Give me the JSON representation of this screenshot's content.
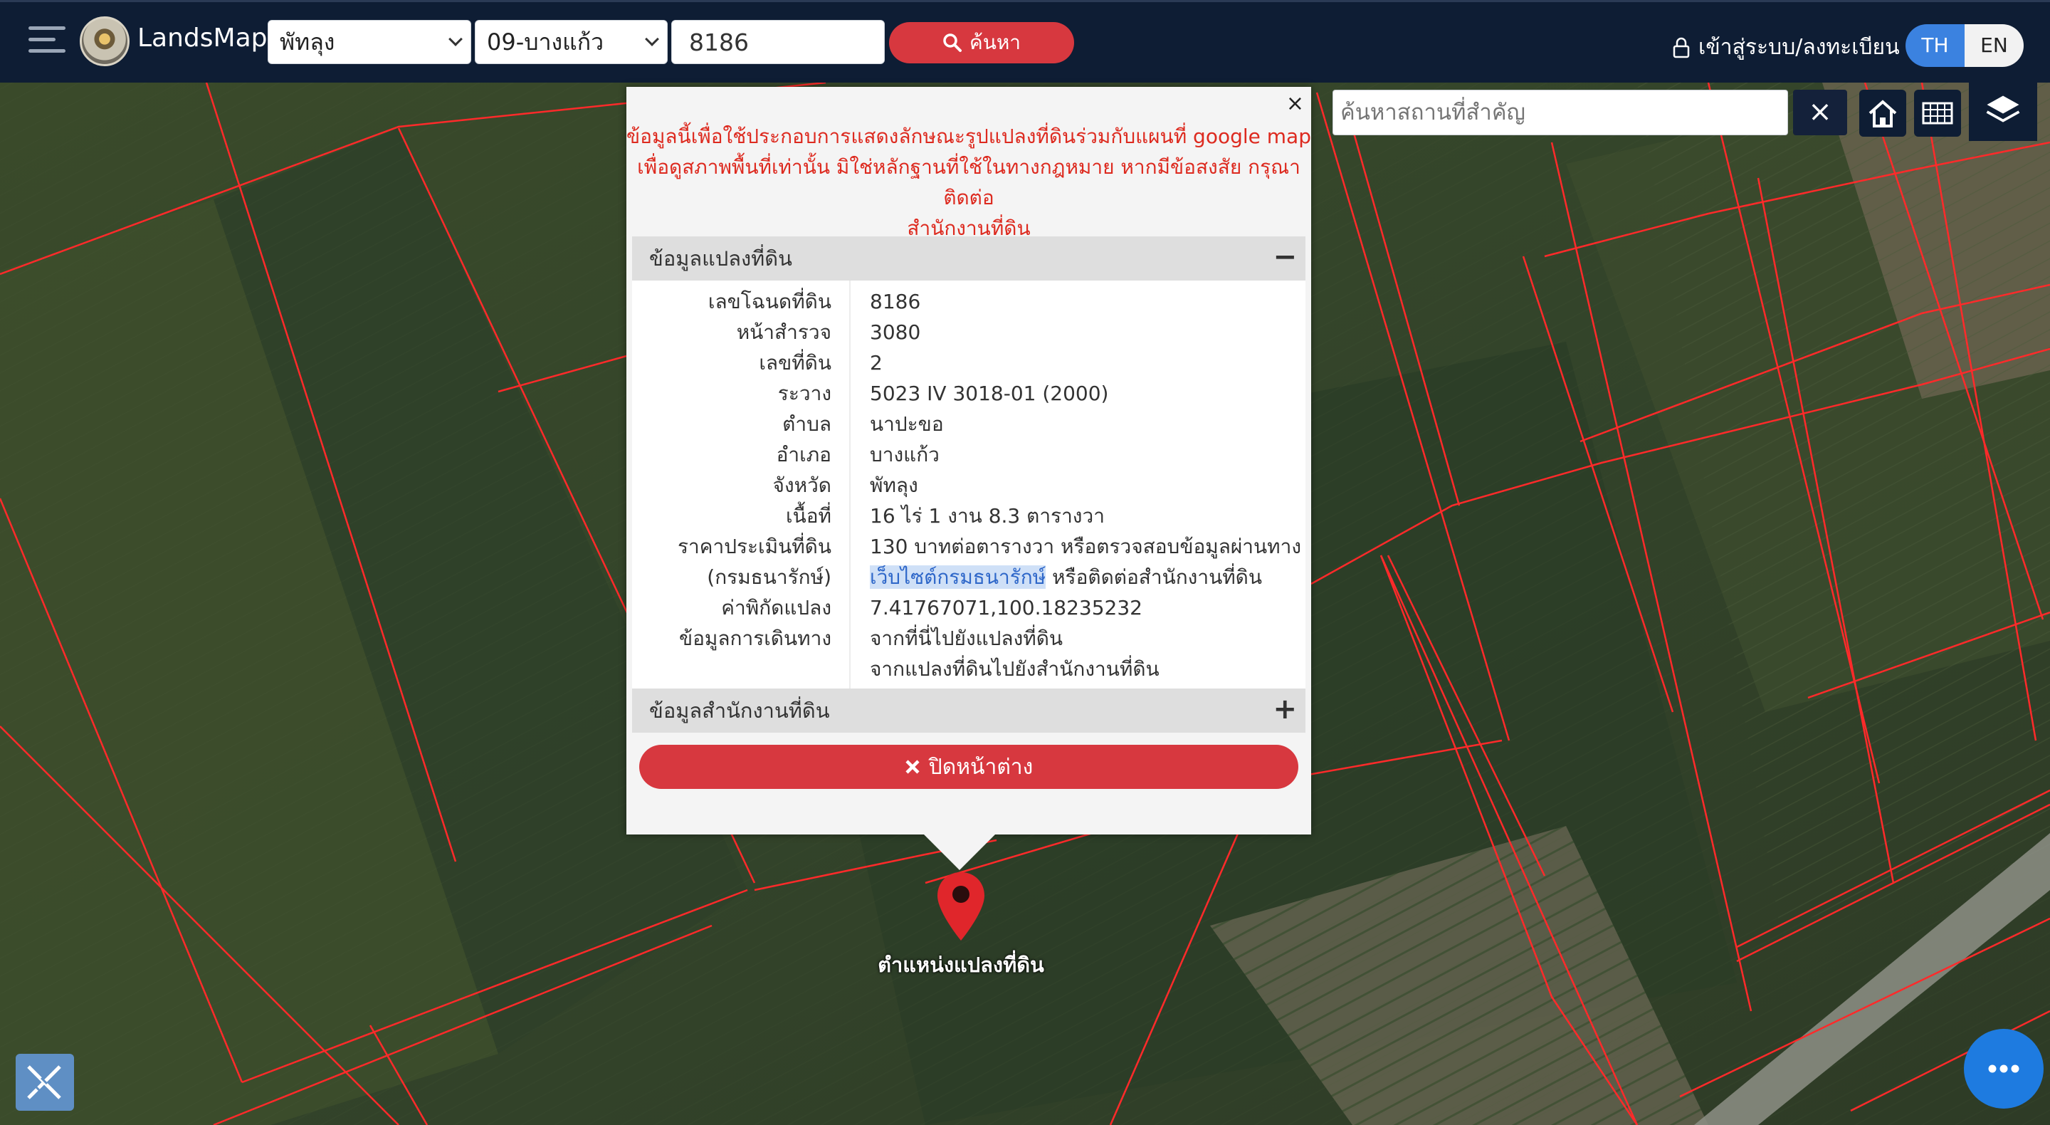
{
  "header": {
    "brand": "LandsMaps",
    "province": "พัทลุง",
    "district": "09-บางแก้ว",
    "parcel_number": "8186",
    "search_label": "ค้นหา",
    "login_label": "เข้าสู่ระบบ/ลงทะเบียน",
    "lang_th": "TH",
    "lang_en": "EN"
  },
  "map_controls": {
    "poi_placeholder": "ค้นหาสถานที่สำคัญ",
    "clear_symbol": "×"
  },
  "popup": {
    "close_symbol": "×",
    "disclaimer_1": "ข้อมูลนี้เพื่อใช้ประกอบการแสดงลักษณะรูปแปลงที่ดินร่วมกับแผนที่ google map",
    "disclaimer_2": "เพื่อดูสภาพพื้นที่เท่านั้น มิใช่หลักฐานที่ใช้ในทางกฎหมาย หากมีข้อสงสัย กรุณาติดต่อ",
    "disclaimer_3": "สำนักงานที่ดิน",
    "section_parcel_title": "ข้อมูลแปลงที่ดิน",
    "section_parcel_toggle": "−",
    "section_office_title": "ข้อมูลสำนักงานที่ดิน",
    "section_office_toggle": "+",
    "close_button_label": "ปิดหน้าต่าง",
    "rows": [
      {
        "label": "เลขโฉนดที่ดิน",
        "value": "8186"
      },
      {
        "label": "หน้าสำรวจ",
        "value": "3080"
      },
      {
        "label": "เลขที่ดิน",
        "value": "2"
      },
      {
        "label": "ระวาง",
        "value": "5023 IV 3018-01 (2000)"
      },
      {
        "label": "ตำบล",
        "value": "นาปะขอ"
      },
      {
        "label": "อำเภอ",
        "value": "บางแก้ว"
      },
      {
        "label": "จังหวัด",
        "value": "พัทลุง"
      },
      {
        "label": "เนื้อที่",
        "value": "16 ไร่ 1 งาน 8.3 ตารางวา"
      }
    ],
    "appraisal": {
      "label_1": "ราคาประเมินที่ดิน",
      "label_2": "(กรมธนารักษ์)",
      "value_1": "130 บาทต่อตารางวา หรือตรวจสอบข้อมูลผ่านทาง",
      "link": "เว็บไซต์กรมธนารักษ์",
      "value_2": " หรือติดต่อสำนักงานที่ดิน"
    },
    "coordinates": {
      "label": "ค่าพิกัดแปลง",
      "value": "7.41767071,100.18235232"
    },
    "directions": {
      "label": "ข้อมูลการเดินทาง",
      "link_1": "จากที่นี่ไปยังแปลงที่ดิน",
      "link_2": "จากแปลงที่ดินไปยังสำนักงานที่ดิน"
    }
  },
  "marker": {
    "label": "ตำแหน่งแปลงที่ดิน",
    "color": "#e0262b"
  },
  "colors": {
    "topbar": "#0e1d34",
    "accent_red": "#d7383f",
    "lang_active": "#3b82e0",
    "parcel_lines": "#ff2a2a"
  }
}
